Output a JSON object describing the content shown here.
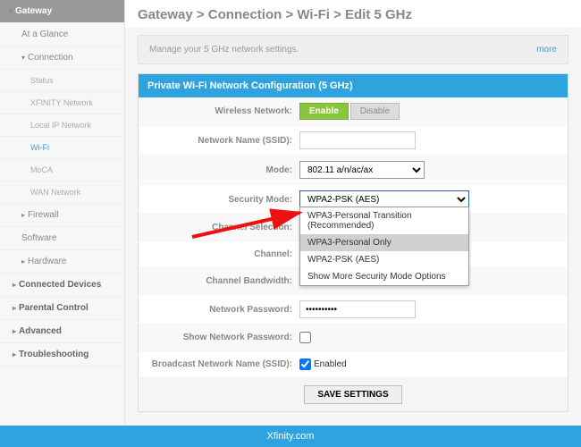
{
  "breadcrumb": "Gateway > Connection > Wi-Fi > Edit 5 GHz",
  "description": "Manage your 5 GHz network settings.",
  "more_link": "more",
  "sidebar": {
    "gateway": "Gateway",
    "at_a_glance": "At a Glance",
    "connection": "Connection",
    "status": "Status",
    "xfinity_network": "XFINITY Network",
    "local_ip": "Local IP Network",
    "wifi": "Wi-Fi",
    "moca": "MoCA",
    "wan": "WAN Network",
    "firewall": "Firewall",
    "software": "Software",
    "hardware": "Hardware",
    "connected_devices": "Connected Devices",
    "parental": "Parental Control",
    "advanced": "Advanced",
    "troubleshooting": "Troubleshooting"
  },
  "panel_header": "Private Wi-Fi Network Configuration (5 GHz)",
  "form": {
    "wireless_network_label": "Wireless Network:",
    "enable": "Enable",
    "disable": "Disable",
    "ssid_label": "Network Name (SSID):",
    "ssid_value": "",
    "mode_label": "Mode:",
    "mode_value": "802.11 a/n/ac/ax",
    "security_mode_label": "Security Mode:",
    "security_mode_value": "WPA2-PSK (AES)",
    "channel_selection_label": "Channel Selection:",
    "channel_label": "Channel:",
    "channel_bandwidth_label": "Channel Bandwidth:",
    "password_label": "Network Password:",
    "password_value": "••••••••••",
    "show_password_label": "Show Network Password:",
    "broadcast_label": "Broadcast Network Name (SSID):",
    "enabled_text": "Enabled",
    "save": "SAVE SETTINGS"
  },
  "dropdown_options": {
    "o0": "WPA3-Personal Transition (Recommended)",
    "o1": "WPA3-Personal Only",
    "o2": "WPA2-PSK (AES)",
    "o3": "Show More Security Mode Options"
  },
  "footer": "Xfinity.com"
}
